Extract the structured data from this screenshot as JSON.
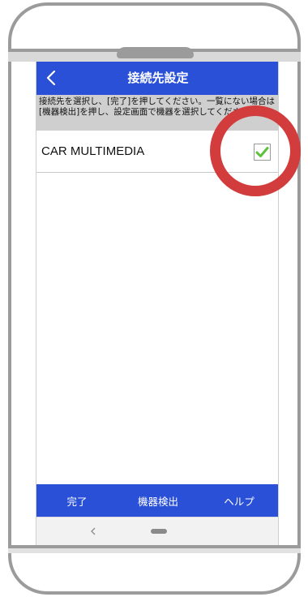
{
  "header": {
    "title": "接続先設定",
    "back_icon": "chevron-left-icon"
  },
  "instruction_text": "接続先を選択し、[完了]を押してください。一覧にない場合は[機器検出]を押し、設定画面で機器を選択してください。",
  "devices": [
    {
      "name": "CAR MULTIMEDIA",
      "checked": true
    }
  ],
  "bottom_bar": {
    "done_label": "完了",
    "detect_label": "機器検出",
    "help_label": "ヘルプ"
  },
  "nav_bar": {
    "back_icon": "back-arrow-icon",
    "home_icon": "home-pill-icon"
  },
  "colors": {
    "primary": "#2b50d8",
    "instruction_bg": "#cfcfcf",
    "check": "#5cc23a",
    "annotation": "#d23c3c",
    "frame": "#9b9b9b"
  }
}
